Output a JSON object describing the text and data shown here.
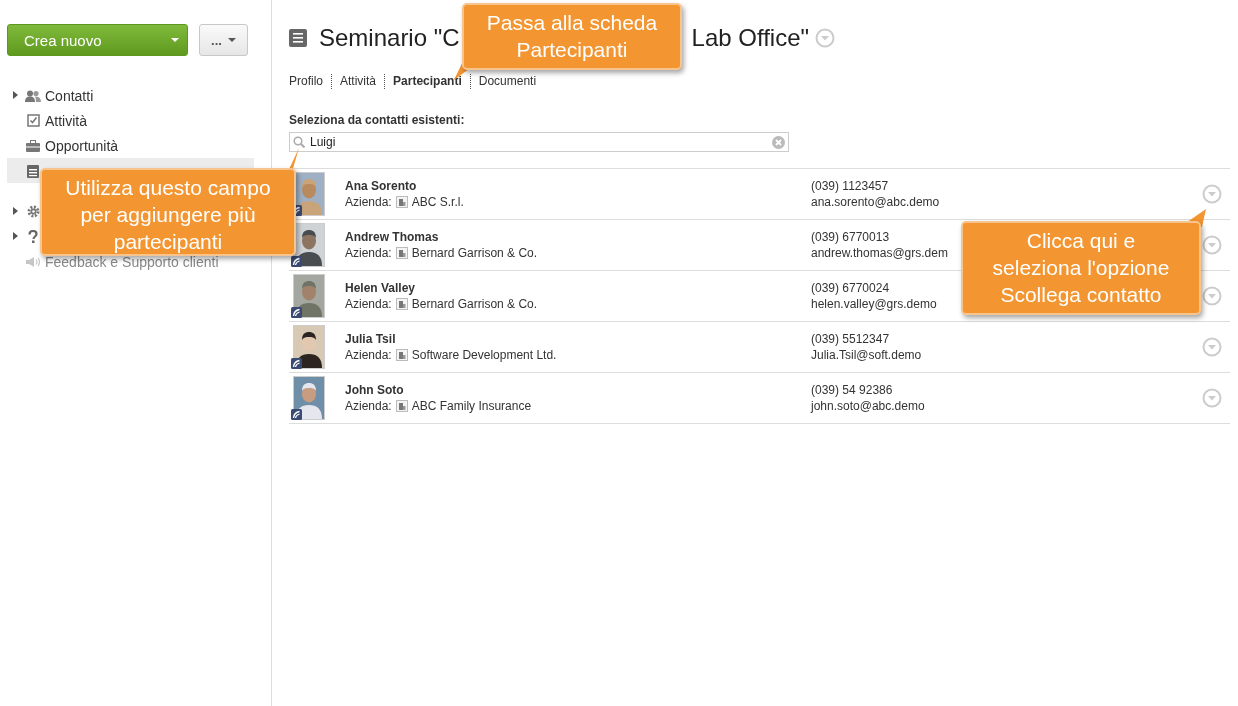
{
  "sidebar": {
    "create_button": "Crea nuovo",
    "more_button": "...",
    "sections": [
      [
        {
          "label": "Contatti",
          "expandable": true,
          "selected": false,
          "disabled": false
        },
        {
          "label": "Attività",
          "expandable": false,
          "selected": false,
          "disabled": false
        },
        {
          "label": "Opportunità",
          "expandable": false,
          "selected": false,
          "disabled": false
        },
        {
          "expandable": false,
          "selected": true,
          "disabled": false
        }
      ],
      [
        {
          "expandable": true,
          "selected": false,
          "disabled": false
        },
        {
          "expandable": true,
          "selected": false,
          "disabled": false
        },
        {
          "label": "Feedback e Supporto clienti",
          "expandable": false,
          "selected": false,
          "disabled": true
        }
      ]
    ]
  },
  "header": {
    "title_parts": [
      "Seminario \"C",
      "Lab Office\""
    ]
  },
  "tabs": [
    {
      "label": "Profilo",
      "selected": false
    },
    {
      "label": "Attività",
      "selected": false
    },
    {
      "label": "Partecipanti",
      "selected": true
    },
    {
      "label": "Documenti",
      "selected": false
    }
  ],
  "search": {
    "label": "Seleziona da contatti esistenti:",
    "value": "Luigi"
  },
  "participants": [
    {
      "name": "Ana Sorento",
      "company_label": "Azienda:",
      "company": "ABC S.r.l.",
      "phone": "(039) 1123457",
      "email": "ana.sorento@abc.demo"
    },
    {
      "name": "Andrew Thomas",
      "company_label": "Azienda:",
      "company": "Bernard Garrison & Co.",
      "phone": "(039) 6770013",
      "email": "andrew.thomas@grs.dem"
    },
    {
      "name": "Helen Valley",
      "company_label": "Azienda:",
      "company": "Bernard Garrison & Co.",
      "phone": "(039) 6770024",
      "email": "helen.valley@grs.demo"
    },
    {
      "name": "Julia Tsil",
      "company_label": "Azienda:",
      "company": "Software Development Ltd.",
      "phone": "(039) 5512347",
      "email": "Julia.Tsil@soft.demo"
    },
    {
      "name": "John Soto",
      "company_label": "Azienda:",
      "company": "ABC Family Insurance",
      "phone": "(039) 54 92386",
      "email": "john.soto@abc.demo"
    }
  ],
  "callouts": [
    {
      "text": "Utilizza questo campo\nper aggiungere più\npartecipanti"
    },
    {
      "text": "Passa alla scheda\nPartecipanti"
    },
    {
      "text": "Clicca qui e\nseleziona l'opzione\nScollega contatto"
    }
  ]
}
